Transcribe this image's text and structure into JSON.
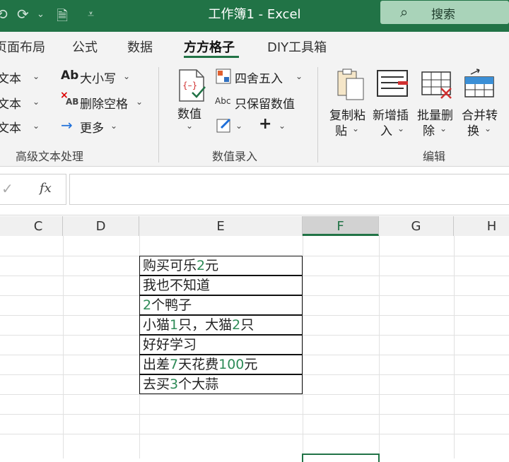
{
  "window": {
    "title": "工作簿1  -  Excel",
    "search_label": "搜索"
  },
  "tabs": [
    {
      "label": "页面布局"
    },
    {
      "label": "公式"
    },
    {
      "label": "数据"
    },
    {
      "label": "方方格子",
      "active": true
    },
    {
      "label": "DIY工具箱"
    }
  ],
  "ribbon": {
    "group1": {
      "items": [
        "文本",
        "文本",
        "文本"
      ],
      "case_label": "大小写",
      "delete_space_label": "删除空格",
      "more_label": "更多",
      "ab_icon_text": "Ab",
      "ab_small_text": "AB",
      "label": "高级文本处理"
    },
    "group2": {
      "value_label": "数值",
      "round_label": "四舍五入",
      "abc_text": "Abc",
      "keep_value_label": "只保留数值",
      "label": "数值录入"
    },
    "group3": {
      "copy_paste": [
        "复制粘",
        "贴"
      ],
      "insert": [
        "新增插",
        "入"
      ],
      "batch_delete": [
        "批量删",
        "除"
      ],
      "merge": [
        "合并转",
        "换"
      ],
      "label": "编辑"
    }
  },
  "formula_bar": {
    "check_symbol": "✓",
    "fx_label": "fx",
    "value": ""
  },
  "columns": [
    "C",
    "D",
    "E",
    "F",
    "G",
    "H"
  ],
  "selected_column": "F",
  "cells": [
    {
      "parts": [
        {
          "t": "购买可乐"
        },
        {
          "t": "2",
          "n": true
        },
        {
          "t": "元"
        }
      ]
    },
    {
      "parts": [
        {
          "t": "我也不知道"
        }
      ]
    },
    {
      "parts": [
        {
          "t": "2",
          "n": true
        },
        {
          "t": "个鸭子"
        }
      ]
    },
    {
      "parts": [
        {
          "t": "小猫"
        },
        {
          "t": "1",
          "n": true
        },
        {
          "t": "只，大猫"
        },
        {
          "t": "2",
          "n": true
        },
        {
          "t": "只"
        }
      ]
    },
    {
      "parts": [
        {
          "t": "好好学习"
        }
      ]
    },
    {
      "parts": [
        {
          "t": "出差"
        },
        {
          "t": "7",
          "n": true
        },
        {
          "t": "天花费"
        },
        {
          "t": "100",
          "n": true
        },
        {
          "t": "元"
        }
      ]
    },
    {
      "parts": [
        {
          "t": "去买"
        },
        {
          "t": "3",
          "n": true
        },
        {
          "t": "个大蒜"
        }
      ]
    }
  ],
  "colors": {
    "accent": "#217346",
    "number_green": "#2e8b57"
  }
}
